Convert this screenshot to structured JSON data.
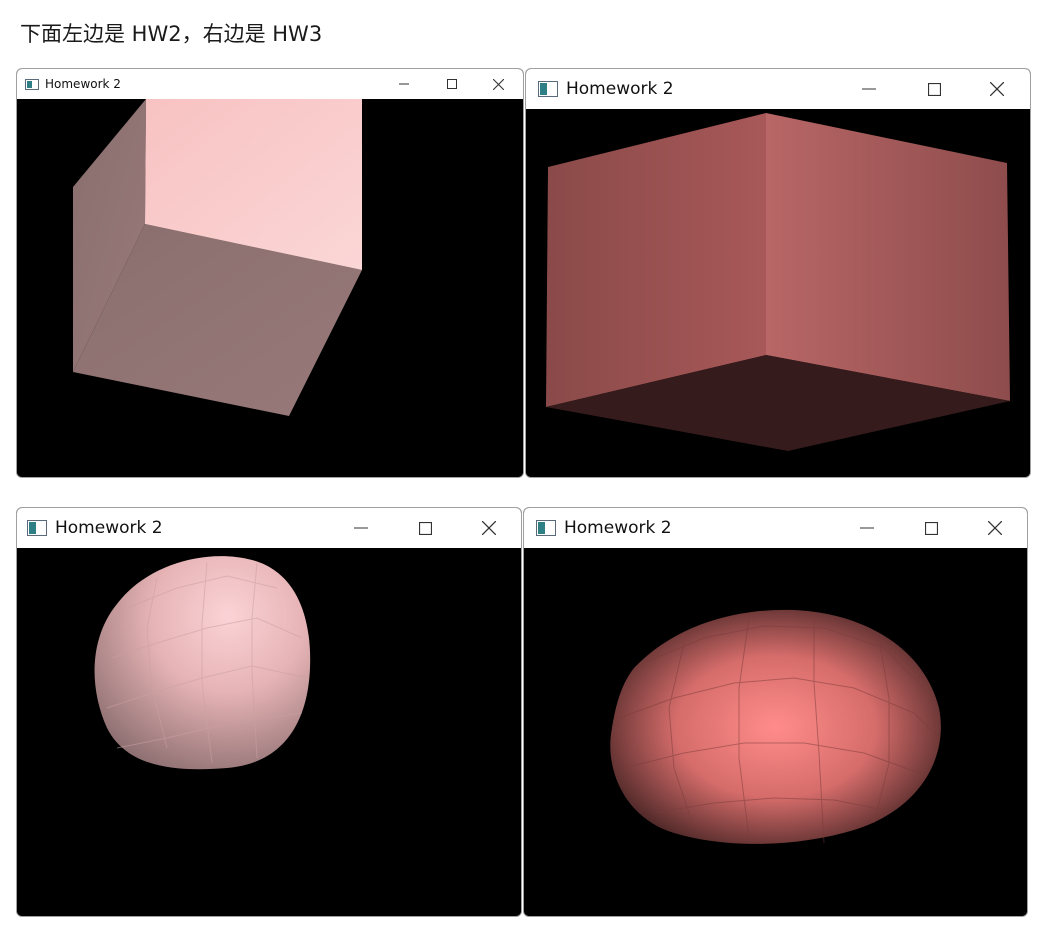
{
  "caption": "下面左边是 HW2，右边是 HW3",
  "windows": [
    {
      "title": "Homework 2",
      "minimize_glyph": "minimize-icon",
      "maximize_glyph": "maximize-icon",
      "close_glyph": "close-icon",
      "scene": "cube view, light pink shading"
    },
    {
      "title": "Homework 2",
      "minimize_glyph": "minimize-icon",
      "maximize_glyph": "maximize-icon",
      "close_glyph": "close-icon",
      "scene": "cube view, salmon shading"
    },
    {
      "title": "Homework 2",
      "minimize_glyph": "minimize-icon",
      "maximize_glyph": "maximize-icon",
      "close_glyph": "close-icon",
      "scene": "subdivided blob, light pink"
    },
    {
      "title": "Homework 2",
      "minimize_glyph": "minimize-icon",
      "maximize_glyph": "maximize-icon",
      "close_glyph": "close-icon",
      "scene": "subdivided blob, salmon"
    }
  ],
  "colors": {
    "hw2_front": "#f9c9c9",
    "hw2_side": "#8e7474",
    "hw3_left": "#94504f",
    "hw3_right": "#b86261",
    "hw3_bottom": "#3a1d1d",
    "background": "#000000"
  }
}
